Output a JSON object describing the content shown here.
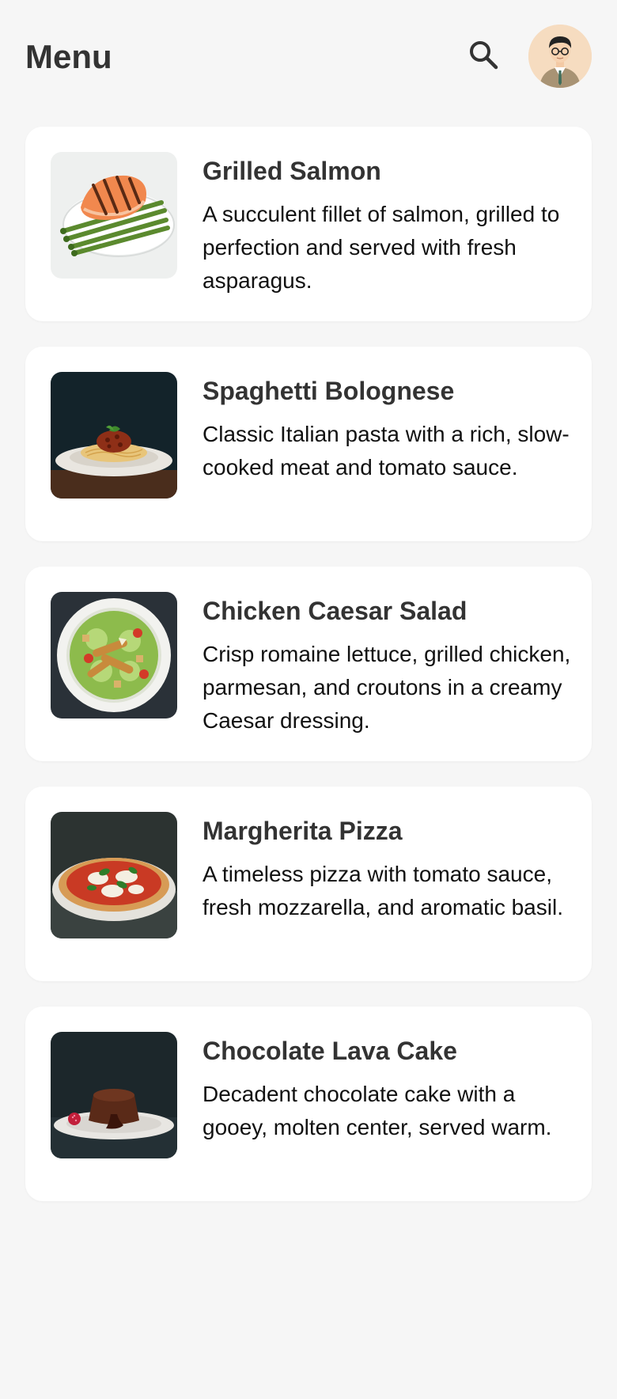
{
  "header": {
    "title": "Menu",
    "search_icon": "search-icon",
    "avatar_icon": "user-avatar"
  },
  "items": [
    {
      "name": "Grilled Salmon",
      "description": "A succulent fillet of salmon, grilled to perfection and served with fresh asparagus."
    },
    {
      "name": "Spaghetti Bolognese",
      "description": "Classic Italian pasta with a rich, slow-cooked meat and tomato sauce."
    },
    {
      "name": "Chicken Caesar Salad",
      "description": "Crisp romaine lettuce, grilled chicken, parmesan, and croutons in a creamy Caesar dressing."
    },
    {
      "name": "Margherita Pizza",
      "description": "A timeless pizza with tomato sauce, fresh mozzarella, and aromatic basil."
    },
    {
      "name": "Chocolate Lava Cake",
      "description": "Decadent chocolate cake with a gooey, molten center, served warm."
    }
  ],
  "colors": {
    "background": "#f6f6f6",
    "card": "#ffffff",
    "avatar_bg": "#f6dcc0"
  }
}
